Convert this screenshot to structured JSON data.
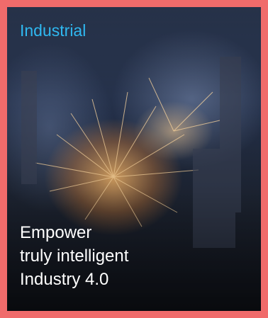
{
  "card": {
    "category": "Industrial",
    "headline_lines": [
      "Empower",
      "truly intelligent",
      "Industry 4.0"
    ]
  },
  "image": {
    "description_icon": "welding-sparks-photo"
  },
  "colors": {
    "frame": "#f06b6b",
    "category_text": "#2fb8f0",
    "headline_text": "#ffffff"
  }
}
